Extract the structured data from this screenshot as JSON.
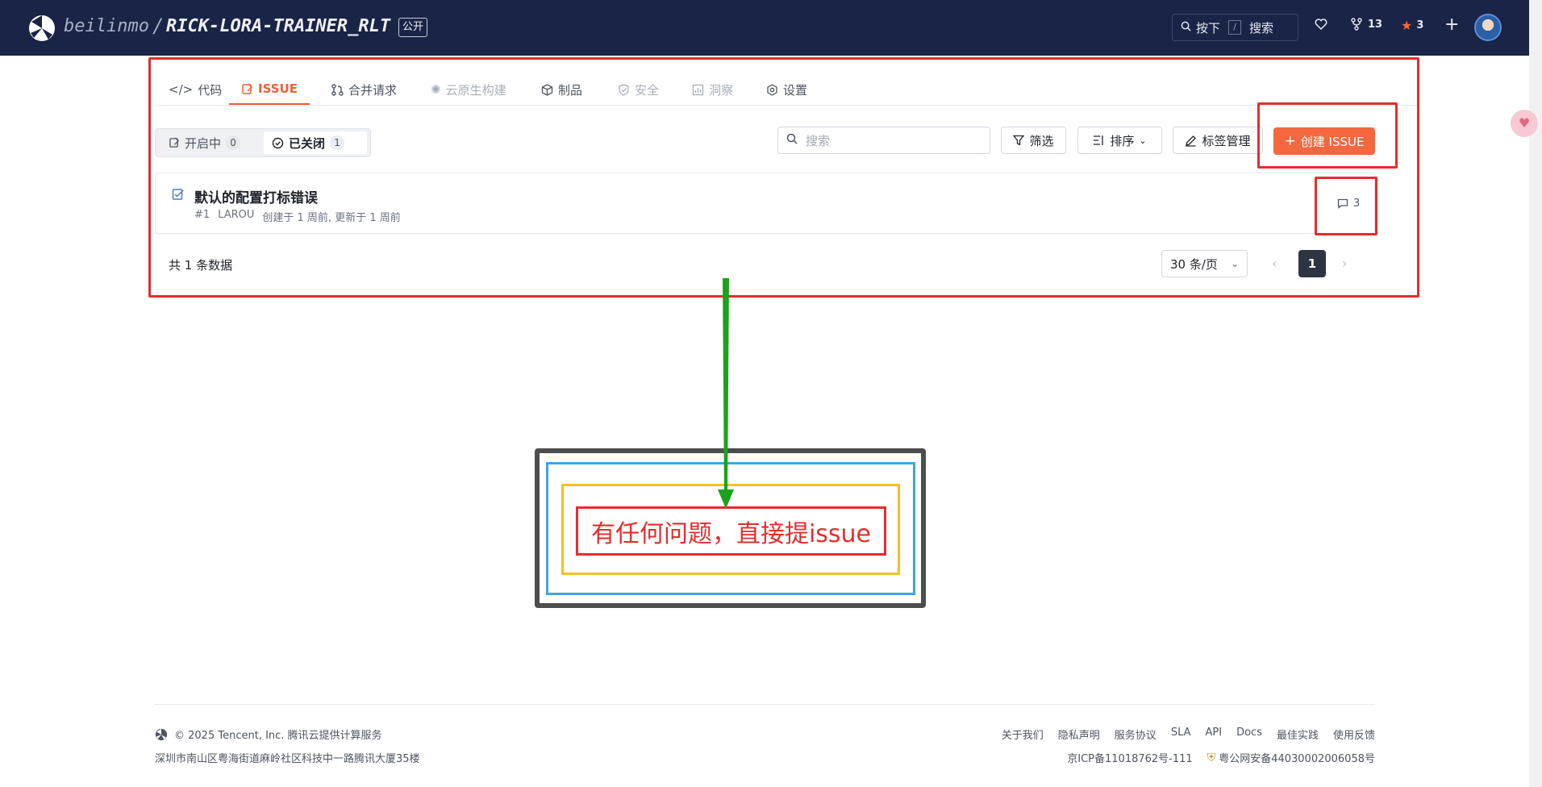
{
  "header": {
    "owner": "beilinmo",
    "separator": "/",
    "repo": "RICK-LORA-TRAINER_RLT",
    "visibility": "公开",
    "search_key_hint": "按下",
    "search_key": "/",
    "search_label": "搜索",
    "fork_count": "13",
    "star_count": "3",
    "plus": "+"
  },
  "tabs": [
    {
      "label": "代码",
      "icon": "code-icon"
    },
    {
      "label": "ISSUE",
      "icon": "issue-icon",
      "active": true
    },
    {
      "label": "合并请求",
      "icon": "merge-request-icon"
    },
    {
      "label": "云原生构建",
      "icon": "cloud-build-icon",
      "disabled": true
    },
    {
      "label": "制品",
      "icon": "package-icon"
    },
    {
      "label": "安全",
      "icon": "shield-icon",
      "disabled": true
    },
    {
      "label": "洞察",
      "icon": "insights-icon",
      "disabled": true
    },
    {
      "label": "设置",
      "icon": "settings-icon"
    }
  ],
  "filter": {
    "open_label": "开启中",
    "open_count": "0",
    "closed_label": "已关闭",
    "closed_count": "1",
    "search_placeholder": "搜索",
    "filter_label": "筛选",
    "sort_label": "排序",
    "labels_label": "标签管理",
    "create_label": "创建 ISSUE"
  },
  "issues": [
    {
      "title": "默认的配置打标错误",
      "number": "#1",
      "author": "LAROU",
      "time": "创建于 1 周前, 更新于 1 周前",
      "comments": "3"
    }
  ],
  "pagination": {
    "total": "共 1 条数据",
    "page_size": "30 条/页",
    "current": "1"
  },
  "annotation": {
    "note": "有任何问题，直接提issue"
  },
  "footer": {
    "copyright": "© 2025 Tencent, Inc. 腾讯云提供计算服务",
    "address": "深圳市南山区粤海街道麻岭社区科技中一路腾讯大厦35楼",
    "links": [
      "关于我们",
      "隐私声明",
      "服务协议",
      "SLA",
      "API",
      "Docs",
      "最佳实践",
      "使用反馈"
    ],
    "icp": "京ICP备11018762号-111",
    "police": "粤公网安备44030002006058号"
  },
  "colors": {
    "topbar": "#1a2447",
    "accent": "#f4673f",
    "annotation_red": "#e32d2d",
    "annotation_green": "#1aa31a",
    "annotation_blue": "#3ea4ea",
    "annotation_yellow": "#f3c21b"
  }
}
